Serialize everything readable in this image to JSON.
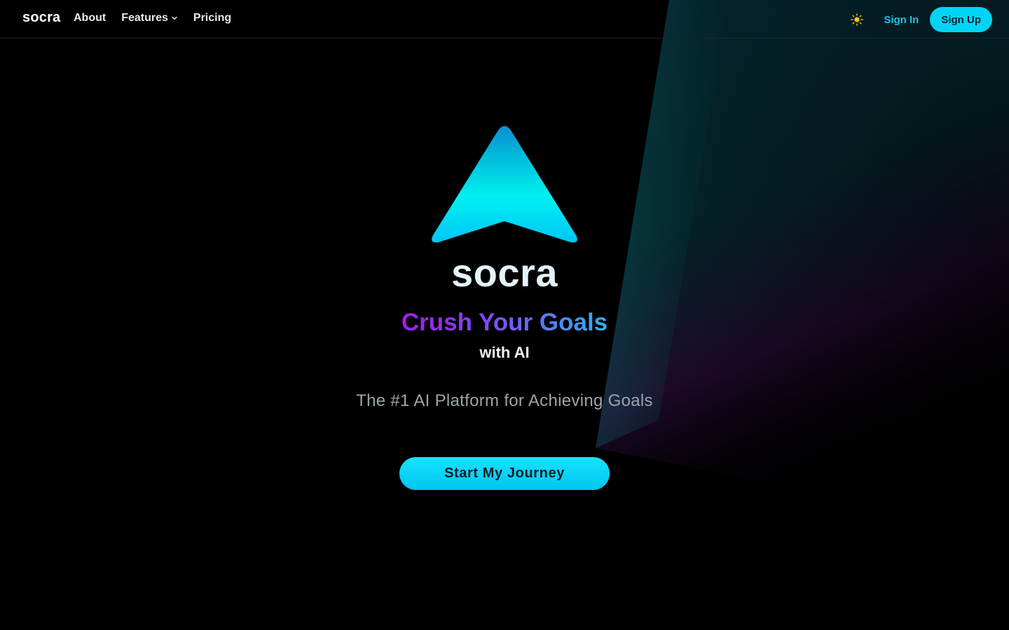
{
  "navbar": {
    "brand": "socra",
    "links": [
      {
        "label": "About"
      },
      {
        "label": "Features"
      },
      {
        "label": "Pricing"
      }
    ],
    "theme_toggle_icon": "sun-icon",
    "signin_label": "Sign In",
    "signup_label": "Sign Up"
  },
  "hero": {
    "wordmark": "socra",
    "headline": "Crush Your Goals",
    "subheadline": "with AI",
    "tagline": "The #1 AI Platform for Achieving Goals",
    "cta_label": "Start My Journey",
    "logo_icon": "arrow-up-logo-icon"
  },
  "colors": {
    "background": "#000000",
    "accent": "#00d4f5",
    "sun": "#f5c400",
    "headline_gradient_start": "#a21cf0",
    "headline_gradient_end": "#2fb2f0"
  }
}
